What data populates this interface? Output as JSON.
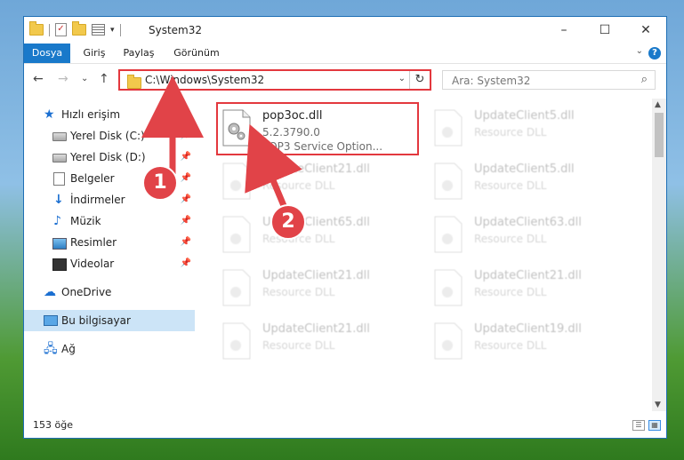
{
  "window": {
    "title": "System32",
    "controls": {
      "minimize": "–",
      "maximize": "☐",
      "close": "✕"
    }
  },
  "ribbon": {
    "tabs": [
      "Dosya",
      "Giriş",
      "Paylaş",
      "Görünüm"
    ],
    "help": "?"
  },
  "nav": {
    "back": "←",
    "forward": "→",
    "recent": "⌄",
    "up": "↑",
    "address": "C:\\Windows\\System32",
    "refresh": "↻",
    "search_placeholder": "Ara: System32",
    "search_icon": "⌕"
  },
  "sidebar": {
    "items": [
      {
        "label": "Hızlı erişim",
        "icon": "star-icon",
        "pinned": false
      },
      {
        "label": "Yerel Disk (C:)",
        "icon": "drive-icon",
        "pinned": true
      },
      {
        "label": "Yerel Disk (D:)",
        "icon": "drive-icon",
        "pinned": true
      },
      {
        "label": "Belgeler",
        "icon": "documents-icon",
        "pinned": true
      },
      {
        "label": "İndirmeler",
        "icon": "download-icon",
        "pinned": true
      },
      {
        "label": "Müzik",
        "icon": "music-icon",
        "pinned": true
      },
      {
        "label": "Resimler",
        "icon": "pictures-icon",
        "pinned": true
      },
      {
        "label": "Videolar",
        "icon": "videos-icon",
        "pinned": true
      },
      {
        "label": "OneDrive",
        "icon": "cloud-icon",
        "pinned": false
      },
      {
        "label": "Bu bilgisayar",
        "icon": "computer-icon",
        "pinned": false,
        "selected": true
      },
      {
        "label": "Ağ",
        "icon": "network-icon",
        "pinned": false
      }
    ],
    "pin_glyph": "📌"
  },
  "files": [
    {
      "name": "pop3oc.dll",
      "line2": "5.2.3790.0",
      "line3": "POP3 Service Option...",
      "highlight": true
    },
    {
      "name": "UpdateClient5.dll",
      "line2": "Resource DLL",
      "line3": ""
    },
    {
      "name": "UpdateClient21.dll",
      "line2": "Resource DLL",
      "line3": ""
    },
    {
      "name": "UpdateClient5.dll",
      "line2": "Resource DLL",
      "line3": ""
    },
    {
      "name": "UpdateClient65.dll",
      "line2": "Resource DLL",
      "line3": ""
    },
    {
      "name": "UpdateClient63.dll",
      "line2": "Resource DLL",
      "line3": ""
    },
    {
      "name": "UpdateClient21.dll",
      "line2": "Resource DLL",
      "line3": ""
    },
    {
      "name": "UpdateClient21.dll",
      "line2": "Resource DLL",
      "line3": ""
    },
    {
      "name": "UpdateClient21.dll",
      "line2": "Resource DLL",
      "line3": ""
    },
    {
      "name": "UpdateClient19.dll",
      "line2": "Resource DLL",
      "line3": ""
    }
  ],
  "status": {
    "count": "153 öğe"
  },
  "callouts": [
    {
      "number": "1"
    },
    {
      "number": "2"
    }
  ],
  "colors": {
    "accent": "#1979ca",
    "highlight": "#e3383e",
    "selection": "#cce4f7"
  }
}
